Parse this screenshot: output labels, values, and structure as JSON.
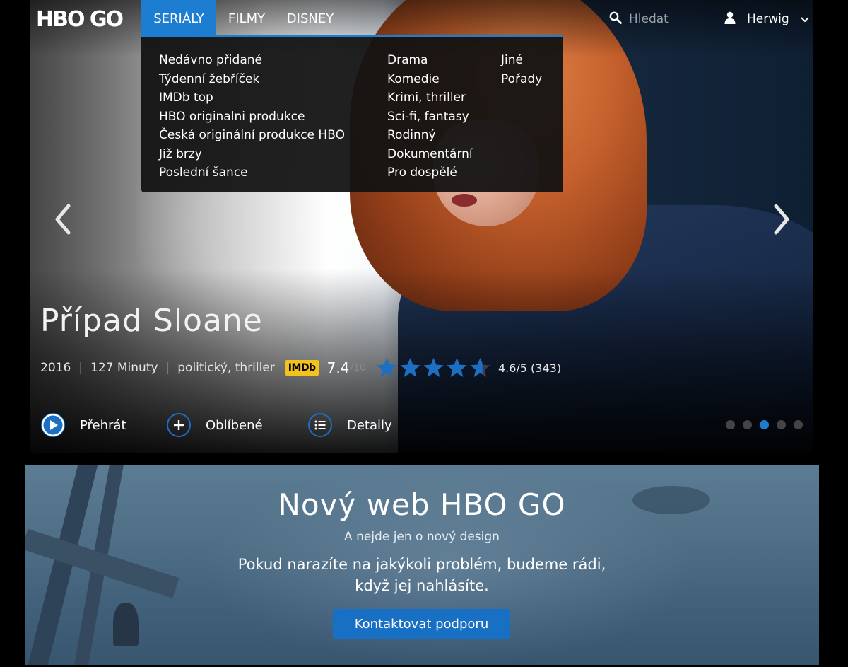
{
  "logo": {
    "text": "HBO GO"
  },
  "nav": {
    "tabs": [
      {
        "label": "SERIÁLY",
        "active": true
      },
      {
        "label": "FILMY",
        "active": false
      },
      {
        "label": "DISNEY",
        "active": false
      }
    ]
  },
  "search": {
    "placeholder": "Hledat",
    "icon": "search-icon"
  },
  "user": {
    "name": "Herwig",
    "icon": "user-icon"
  },
  "dropdown": {
    "sections": [
      "Nedávno přidané",
      "Týdenní žebříček",
      "IMDb top",
      "HBO originalni produkce",
      "Česká originální produkce HBO",
      "Již brzy",
      "Poslední šance"
    ],
    "genres": [
      "Drama",
      "Komedie",
      "Krimi, thriller",
      "Sci-fi, fantasy",
      "Rodinný",
      "Dokumentární",
      "Pro dospělé"
    ],
    "other": [
      "Jiné",
      "Pořady"
    ]
  },
  "hero": {
    "title": "Případ Sloane",
    "year": "2016",
    "duration": "127 Minuty",
    "genres": "politický, thriller",
    "imdb_label": "IMDb",
    "imdb_score": "7.4",
    "imdb_max": "/10",
    "stars_value": 4.6,
    "rating_text": "4.6/5 (343)",
    "actions": {
      "play": "Přehrát",
      "favorite": "Oblíbené",
      "details": "Detaily"
    },
    "carousel": {
      "count": 5,
      "active_index": 2
    }
  },
  "banner": {
    "title": "Nový web HBO GO",
    "subtitle": "A nejde jen o nový design",
    "message": "Pokud narazíte na jakýkoli problém, budeme rádi, když jej nahlásíte.",
    "button": "Kontaktovat podporu"
  },
  "colors": {
    "accent": "#1d7ed1",
    "imdb": "#f3c21b",
    "star": "#1d6fc4",
    "background": "#000000"
  }
}
